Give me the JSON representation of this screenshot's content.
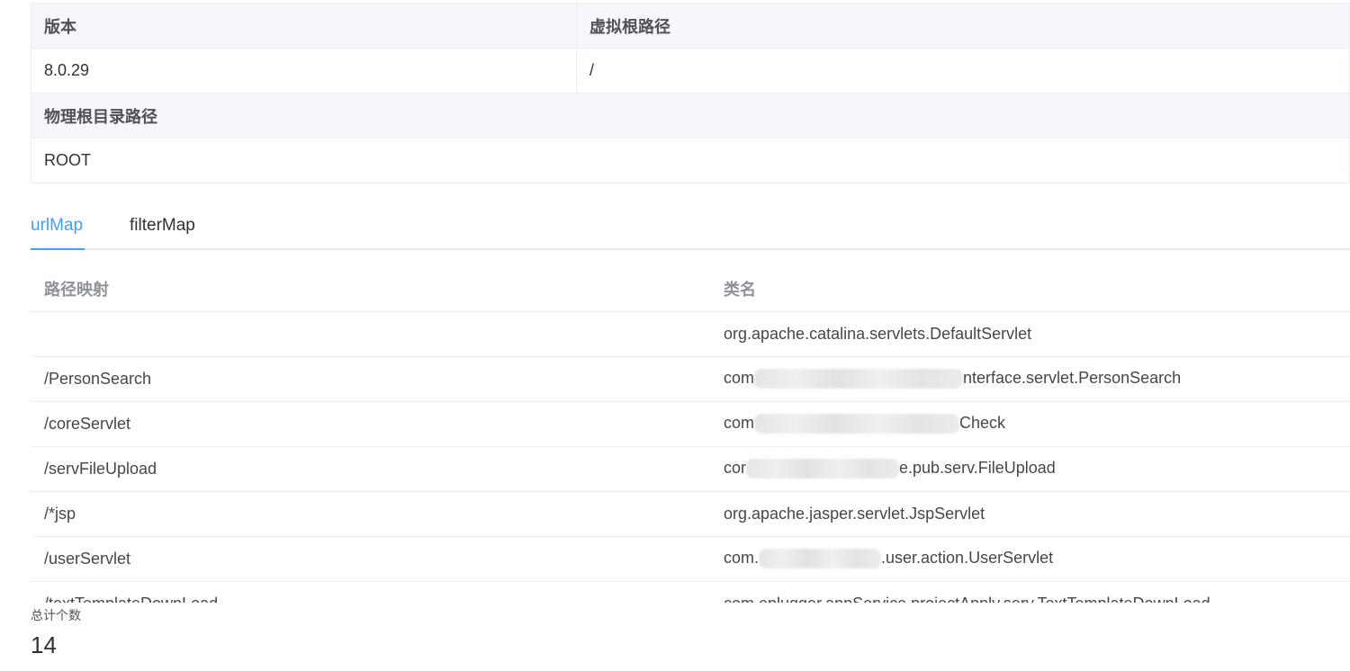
{
  "descriptions": {
    "version_label": "版本",
    "virtual_root_label": "虚拟根路径",
    "version_value": "8.0.29",
    "virtual_root_value": "/",
    "physical_root_label": "物理根目录路径",
    "physical_root_value": "ROOT"
  },
  "tabs": [
    {
      "label": "urlMap",
      "active": true
    },
    {
      "label": "filterMap",
      "active": false
    }
  ],
  "table": {
    "columns": [
      "路径映射",
      "类名"
    ],
    "rows": [
      {
        "path": "",
        "class_prefix": "org.apache.catalina.servlets.DefaultServlet",
        "class_suffix": "",
        "redacted": false
      },
      {
        "path": "/PersonSearch",
        "class_prefix": "com",
        "class_suffix": "nterface.servlet.PersonSearch",
        "redacted": true
      },
      {
        "path": "/coreServlet",
        "class_prefix": "com",
        "class_suffix": "Check",
        "redacted": true
      },
      {
        "path": "/servFileUpload",
        "class_prefix": "cor",
        "class_suffix": "e.pub.serv.FileUpload",
        "redacted": true
      },
      {
        "path": "/*jsp",
        "class_prefix": "org.apache.jasper.servlet.JspServlet",
        "class_suffix": "",
        "redacted": false
      },
      {
        "path": "/userServlet",
        "class_prefix": "com.",
        "class_suffix": ".user.action.UserServlet",
        "redacted": true
      },
      {
        "path": "/textTemplateDownLoad",
        "class_prefix": "com.eplugger.appService.projectApply.serv.TextTemplateDownLoad",
        "class_suffix": "",
        "redacted": false
      }
    ]
  },
  "stat": {
    "label": "总计个数",
    "value": "14"
  },
  "colors": {
    "accent": "#409eff",
    "label_bg": "#f5f7fa",
    "border": "#ebeef5"
  }
}
